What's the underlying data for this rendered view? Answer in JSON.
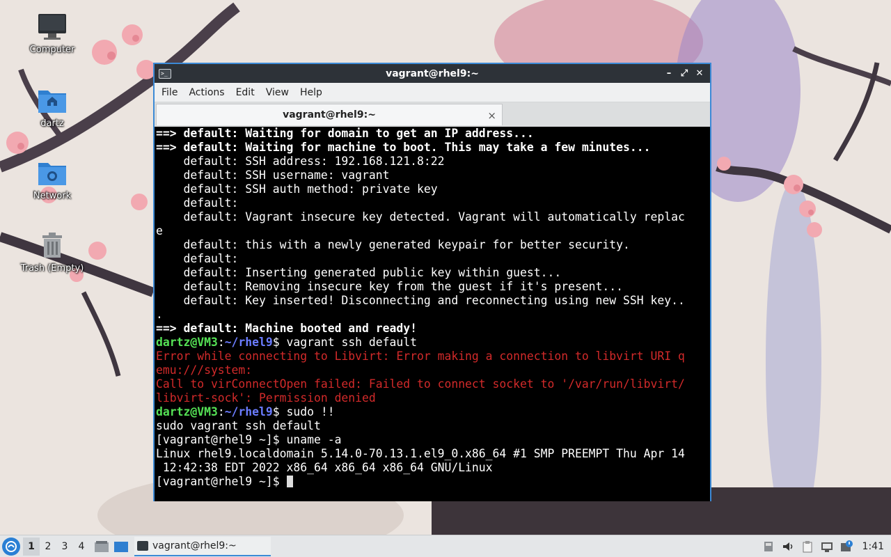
{
  "desktop": {
    "icons": [
      {
        "label": "Computer"
      },
      {
        "label": "dartz"
      },
      {
        "label": "Network"
      },
      {
        "label": "Trash (Empty)"
      }
    ]
  },
  "window": {
    "title": "vagrant@rhel9:~",
    "menus": [
      "File",
      "Actions",
      "Edit",
      "View",
      "Help"
    ],
    "tab_label": "vagrant@rhel9:~",
    "tab_close": "×",
    "controls": {
      "minimize": "–",
      "maximize": "⤢",
      "close": "✕"
    }
  },
  "terminal": {
    "lines": [
      [
        {
          "t": "==> default: Waiting for domain to get an IP address...",
          "s": "bold"
        }
      ],
      [
        {
          "t": "==> default: Waiting for machine to boot. This may take a few minutes...",
          "s": "bold"
        }
      ],
      [
        {
          "t": "    default: SSH address: 192.168.121.8:22",
          "s": "plain"
        }
      ],
      [
        {
          "t": "    default: SSH username: vagrant",
          "s": "plain"
        }
      ],
      [
        {
          "t": "    default: SSH auth method: private key",
          "s": "plain"
        }
      ],
      [
        {
          "t": "    default:",
          "s": "plain"
        }
      ],
      [
        {
          "t": "    default: Vagrant insecure key detected. Vagrant will automatically replac",
          "s": "plain"
        }
      ],
      [
        {
          "t": "e",
          "s": "plain"
        }
      ],
      [
        {
          "t": "    default: this with a newly generated keypair for better security.",
          "s": "plain"
        }
      ],
      [
        {
          "t": "    default:",
          "s": "plain"
        }
      ],
      [
        {
          "t": "    default: Inserting generated public key within guest...",
          "s": "plain"
        }
      ],
      [
        {
          "t": "    default: Removing insecure key from the guest if it's present...",
          "s": "plain"
        }
      ],
      [
        {
          "t": "    default: Key inserted! Disconnecting and reconnecting using new SSH key..",
          "s": "plain"
        }
      ],
      [
        {
          "t": ".",
          "s": "plain"
        }
      ],
      [
        {
          "t": "==> default: Machine booted and ready!",
          "s": "bold"
        }
      ],
      [
        {
          "t": "dartz@VM3",
          "s": "user"
        },
        {
          "t": ":",
          "s": "plain"
        },
        {
          "t": "~/rhel9",
          "s": "path"
        },
        {
          "t": "$ vagrant ssh default",
          "s": "plain"
        }
      ],
      [
        {
          "t": "Error while connecting to Libvirt: Error making a connection to libvirt URI q",
          "s": "err"
        }
      ],
      [
        {
          "t": "emu:///system:",
          "s": "err"
        }
      ],
      [
        {
          "t": "Call to virConnectOpen failed: Failed to connect socket to '/var/run/libvirt/",
          "s": "err"
        }
      ],
      [
        {
          "t": "libvirt-sock': Permission denied",
          "s": "err"
        }
      ],
      [
        {
          "t": "dartz@VM3",
          "s": "user"
        },
        {
          "t": ":",
          "s": "plain"
        },
        {
          "t": "~/rhel9",
          "s": "path"
        },
        {
          "t": "$ sudo !!",
          "s": "plain"
        }
      ],
      [
        {
          "t": "sudo vagrant ssh default",
          "s": "plain"
        }
      ],
      [
        {
          "t": "[vagrant@rhel9 ~]$ uname -a",
          "s": "plain"
        }
      ],
      [
        {
          "t": "Linux rhel9.localdomain 5.14.0-70.13.1.el9_0.x86_64 #1 SMP PREEMPT Thu Apr 14",
          "s": "plain"
        }
      ],
      [
        {
          "t": " 12:42:38 EDT 2022 x86_64 x86_64 x86_64 GNU/Linux",
          "s": "plain"
        }
      ],
      [
        {
          "t": "[vagrant@rhel9 ~]$ ",
          "s": "plain"
        },
        {
          "t": "",
          "s": "cursor"
        }
      ]
    ]
  },
  "taskbar": {
    "start_icon": "lxqt-start-icon",
    "workspaces": [
      "1",
      "2",
      "3",
      "4"
    ],
    "active_workspace": "1",
    "task_label": "vagrant@rhel9:~",
    "clock": "1:41"
  },
  "colors": {
    "window_border": "#3c8ad6",
    "error_text": "#d22a2a",
    "prompt_user": "#55e155",
    "prompt_path": "#6b7cff"
  }
}
